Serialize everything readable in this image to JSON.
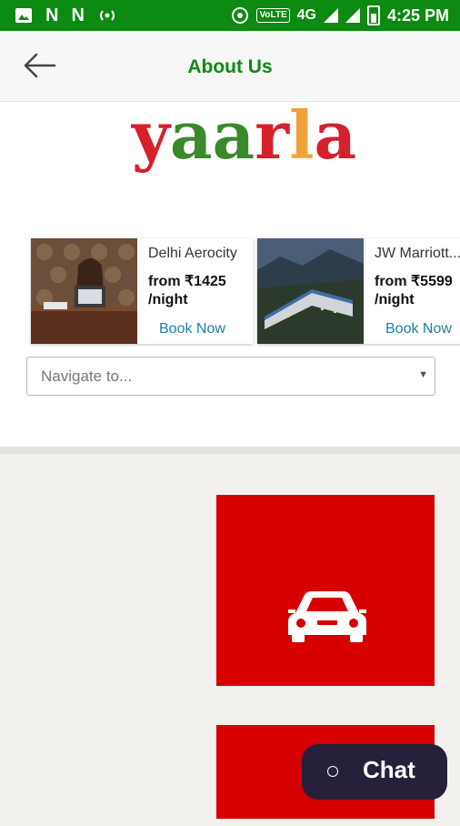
{
  "status_bar": {
    "network": "4G",
    "volte": "VoLTE",
    "time": "4:25 PM"
  },
  "app_bar": {
    "title": "About Us"
  },
  "logo": {
    "letters": [
      {
        "char": "y",
        "color": "#d6202b"
      },
      {
        "char": "a",
        "color": "#3a8a2a"
      },
      {
        "char": "a",
        "color": "#3a8a2a"
      },
      {
        "char": "r",
        "color": "#d6202b"
      },
      {
        "char": "l",
        "color": "#f0a23a"
      },
      {
        "char": "a",
        "color": "#d6202b"
      }
    ]
  },
  "hotels": [
    {
      "name": "Delhi Aerocity",
      "price_line1": "from ₹1425",
      "price_line2": "/night",
      "book_label": "Book Now"
    },
    {
      "name": "JW Marriott...",
      "price_line1": "from ₹5599",
      "price_line2": "/night",
      "book_label": "Book Now"
    }
  ],
  "navigate": {
    "placeholder": "Navigate to..."
  },
  "chat": {
    "label": "Chat"
  },
  "colors": {
    "status_bar": "#0c8a12",
    "title_green": "#0c8a12",
    "tile_red": "#d60000",
    "book_link": "#1b7fa8",
    "chat_bg": "#26203a"
  },
  "icons": [
    "image-icon",
    "n-notification-icon",
    "hotspot-icon",
    "wifi-calling-icon",
    "signal-icon",
    "battery-icon",
    "back-arrow-icon",
    "car-icon",
    "chat-bubble-icon",
    "dropdown-arrow-icon"
  ]
}
